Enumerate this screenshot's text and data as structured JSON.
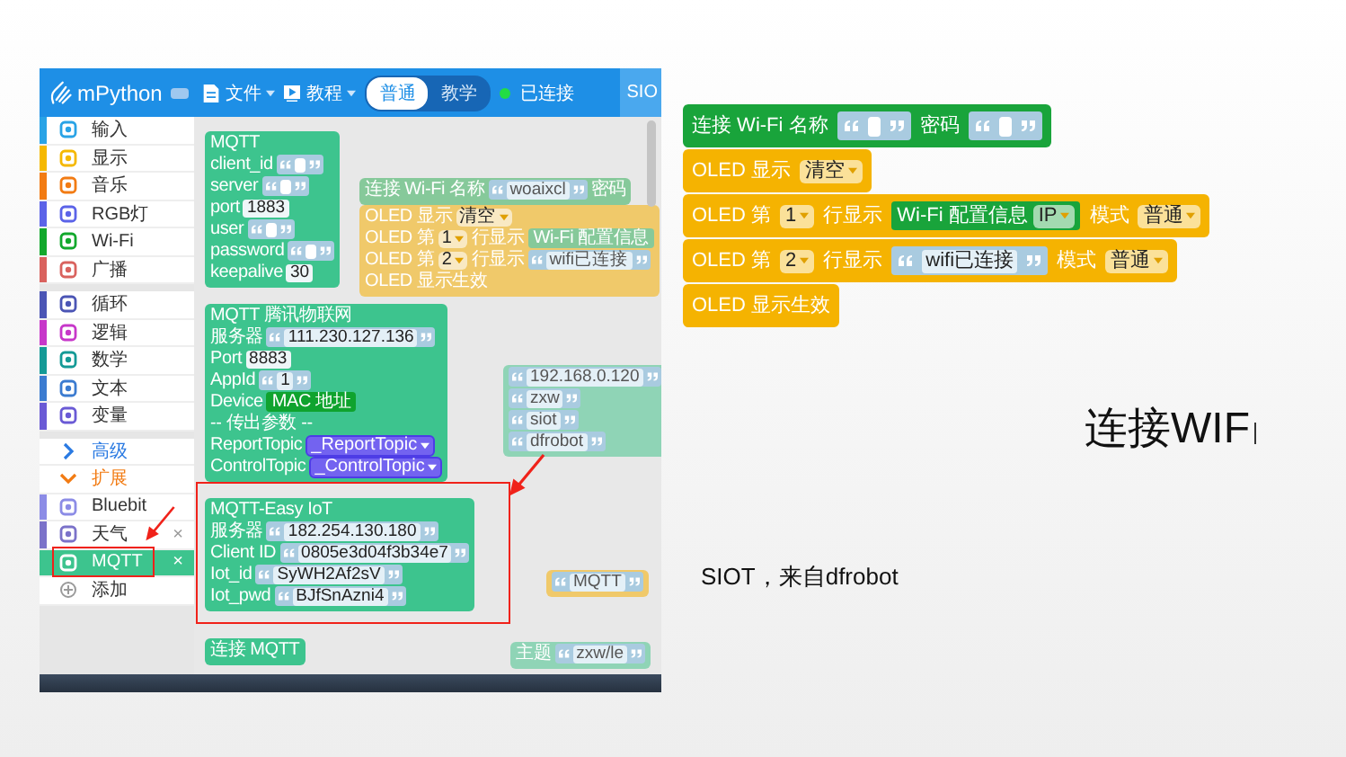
{
  "editor": {
    "logo": "mPython",
    "menus": [
      {
        "label": "文件",
        "kind": "file"
      },
      {
        "label": "教程",
        "kind": "tutorial"
      }
    ],
    "modes": [
      {
        "label": "普通",
        "selected": true
      },
      {
        "label": "教学",
        "selected": false
      }
    ],
    "connection": {
      "label": "已连接",
      "connected": true
    },
    "cut_button": "SIO",
    "sidebar": [
      [
        {
          "label": "输入",
          "kind": "category",
          "color": "#29a3e6"
        },
        {
          "label": "显示",
          "kind": "category",
          "color": "#f5b800"
        },
        {
          "label": "音乐",
          "kind": "category",
          "color": "#f27b13"
        },
        {
          "label": "RGB灯",
          "kind": "category",
          "color": "#5b63e8"
        },
        {
          "label": "Wi-Fi",
          "kind": "category",
          "color": "#12a82c"
        },
        {
          "label": "广播",
          "kind": "category",
          "color": "#d9625e"
        }
      ],
      [
        {
          "label": "循环",
          "kind": "category",
          "color": "#4b55b5"
        },
        {
          "label": "逻辑",
          "kind": "category",
          "color": "#c737c9"
        },
        {
          "label": "数学",
          "kind": "category",
          "color": "#149a96"
        },
        {
          "label": "文本",
          "kind": "category",
          "color": "#3b7bd0"
        },
        {
          "label": "变量",
          "kind": "category",
          "color": "#6a5ad5"
        }
      ],
      [
        {
          "label": "高级",
          "kind": "folder",
          "color": "#2a7ae2",
          "expanded": false
        },
        {
          "label": "扩展",
          "kind": "folder",
          "color": "#f27b13",
          "expanded": true
        },
        {
          "label": "Bluebit",
          "kind": "extension",
          "color": "#8c8ce6",
          "selected": false,
          "highlighted": false
        },
        {
          "label": "天气",
          "kind": "extension",
          "color": "#7b72c9",
          "close": "×",
          "selected": false,
          "highlighted": false
        },
        {
          "label": "MQTT",
          "kind": "extension",
          "color": "#3dc48e",
          "close": "×",
          "selected": true,
          "highlighted": true
        },
        {
          "label": "添加",
          "kind": "add",
          "color": "#9a9a9a"
        }
      ]
    ],
    "canvas_blocks": [
      {
        "color": "#3dc48e",
        "highlighted": false,
        "rows": [
          {
            "items": [
              {
                "kind": "label",
                "text": "MQTT"
              }
            ]
          },
          {
            "items": [
              {
                "kind": "label",
                "text": "client_id"
              },
              {
                "kind": "string"
              }
            ]
          },
          {
            "items": [
              {
                "kind": "label",
                "text": "server"
              },
              {
                "kind": "string"
              }
            ]
          },
          {
            "items": [
              {
                "kind": "label",
                "text": "port"
              },
              {
                "kind": "number",
                "value": "1883"
              }
            ]
          },
          {
            "items": [
              {
                "kind": "label",
                "text": "user"
              },
              {
                "kind": "string"
              }
            ]
          },
          {
            "items": [
              {
                "kind": "label",
                "text": "password"
              },
              {
                "kind": "string"
              }
            ]
          },
          {
            "items": [
              {
                "kind": "label",
                "text": "keepalive"
              },
              {
                "kind": "number",
                "value": "30"
              }
            ]
          }
        ]
      },
      {
        "color": "#3dc48e",
        "highlighted": false,
        "rows": [
          {
            "items": [
              {
                "kind": "label",
                "text": "MQTT 腾讯物联网"
              }
            ]
          },
          {
            "items": [
              {
                "kind": "label",
                "text": "服务器"
              },
              {
                "kind": "string",
                "value": "111.230.127.136"
              }
            ]
          },
          {
            "items": [
              {
                "kind": "label",
                "text": "Port"
              },
              {
                "kind": "number",
                "value": "8883"
              }
            ]
          },
          {
            "items": [
              {
                "kind": "label",
                "text": "AppId"
              },
              {
                "kind": "string",
                "value": "1"
              }
            ]
          },
          {
            "items": [
              {
                "kind": "label",
                "text": "Device"
              },
              {
                "kind": "reporter",
                "color": "#0fa32e",
                "items": [
                  {
                    "kind": "label",
                    "text": "MAC 地址"
                  }
                ]
              }
            ]
          },
          {
            "items": [
              {
                "kind": "label",
                "text": "-- 传出参数 --"
              }
            ]
          },
          {
            "items": [
              {
                "kind": "label",
                "text": "ReportTopic"
              },
              {
                "kind": "dropdown",
                "value": "_ReportTopic",
                "color": "#7363f0"
              }
            ]
          },
          {
            "items": [
              {
                "kind": "label",
                "text": "ControlTopic"
              },
              {
                "kind": "dropdown",
                "value": "_ControlTopic",
                "color": "#7363f0"
              }
            ]
          }
        ]
      },
      {
        "color": "#3dc48e",
        "highlighted": true,
        "rows": [
          {
            "items": [
              {
                "kind": "label",
                "text": "MQTT-Easy IoT"
              }
            ]
          },
          {
            "items": [
              {
                "kind": "label",
                "text": "服务器"
              },
              {
                "kind": "string",
                "value": "182.254.130.180"
              }
            ]
          },
          {
            "items": [
              {
                "kind": "label",
                "text": "Client ID"
              },
              {
                "kind": "string",
                "value": "0805e3d04f3b34e7"
              }
            ]
          },
          {
            "items": [
              {
                "kind": "label",
                "text": "Iot_id"
              },
              {
                "kind": "string",
                "value": "SyWH2Af2sV"
              }
            ]
          },
          {
            "items": [
              {
                "kind": "label",
                "text": "Iot_pwd"
              },
              {
                "kind": "string",
                "value": "BJfSnAzni4"
              }
            ]
          }
        ]
      },
      {
        "color": "#3dc48e",
        "highlighted": false,
        "rows": [
          {
            "items": [
              {
                "kind": "label",
                "text": "连接 MQTT"
              }
            ]
          }
        ]
      }
    ],
    "background_blocks": [
      {
        "kind": "wifi",
        "rows": [
          {
            "items": [
              {
                "kind": "label",
                "text": "连接 Wi-Fi 名称"
              },
              {
                "kind": "string",
                "value": "woaixcl"
              },
              {
                "kind": "label",
                "text": "密码"
              }
            ]
          }
        ]
      },
      {
        "kind": "display",
        "rows": [
          {
            "items": [
              {
                "kind": "label",
                "text": "OLED 显示"
              },
              {
                "kind": "dropdown",
                "value": "清空"
              }
            ]
          },
          {
            "items": [
              {
                "kind": "label",
                "text": "OLED 第"
              },
              {
                "kind": "dropdown",
                "value": "1"
              },
              {
                "kind": "label",
                "text": "行显示"
              },
              {
                "kind": "reporter",
                "items": [
                  {
                    "kind": "label",
                    "text": "Wi-Fi 配置信息"
                  }
                ]
              }
            ]
          },
          {
            "items": [
              {
                "kind": "label",
                "text": "OLED 第"
              },
              {
                "kind": "dropdown",
                "value": "2"
              },
              {
                "kind": "label",
                "text": "行显示"
              },
              {
                "kind": "string",
                "value": "wifi已连接"
              }
            ]
          },
          {
            "items": [
              {
                "kind": "label",
                "text": "OLED 显示生效"
              }
            ]
          }
        ]
      },
      {
        "kind": "mqtt",
        "rows": [
          {
            "items": [
              {
                "kind": "string",
                "value": "192.168.0.120"
              }
            ]
          },
          {
            "items": [
              {
                "kind": "string",
                "value": "zxw"
              }
            ]
          },
          {
            "items": [
              {
                "kind": "string",
                "value": "siot"
              }
            ]
          },
          {
            "items": [
              {
                "kind": "string",
                "value": "dfrobot"
              }
            ]
          }
        ]
      },
      {
        "kind": "display",
        "rows": [
          {
            "items": [
              {
                "kind": "string",
                "value": "MQTT"
              }
            ]
          }
        ]
      },
      {
        "kind": "mqtt",
        "rows": [
          {
            "items": [
              {
                "kind": "label",
                "text": "主题"
              },
              {
                "kind": "string",
                "value": "zxw/le"
              }
            ]
          }
        ]
      }
    ]
  },
  "slide_blocks": [
    {
      "color": "#19a43b",
      "rows": [
        {
          "items": [
            {
              "kind": "label",
              "text": "连接 Wi-Fi 名称"
            },
            {
              "kind": "string"
            },
            {
              "kind": "label",
              "text": "密码"
            },
            {
              "kind": "string"
            }
          ]
        }
      ]
    },
    {
      "color": "#f5b301",
      "rows": [
        {
          "items": [
            {
              "kind": "label",
              "text": "OLED 显示"
            },
            {
              "kind": "dropdown",
              "value": "清空"
            }
          ]
        }
      ]
    },
    {
      "color": "#f5b301",
      "rows": [
        {
          "items": [
            {
              "kind": "label",
              "text": "OLED 第"
            },
            {
              "kind": "dropdown",
              "value": "1"
            },
            {
              "kind": "label",
              "text": "行显示"
            },
            {
              "kind": "reporter",
              "color": "#19a43b",
              "items": [
                {
                  "kind": "label",
                  "text": "Wi-Fi 配置信息"
                },
                {
                  "kind": "dropdown",
                  "value": "IP"
                }
              ]
            },
            {
              "kind": "label",
              "text": "模式"
            },
            {
              "kind": "dropdown",
              "value": "普通"
            }
          ]
        }
      ]
    },
    {
      "color": "#f5b301",
      "rows": [
        {
          "items": [
            {
              "kind": "label",
              "text": "OLED 第"
            },
            {
              "kind": "dropdown",
              "value": "2"
            },
            {
              "kind": "label",
              "text": "行显示"
            },
            {
              "kind": "string",
              "value": "wifi已连接"
            },
            {
              "kind": "label",
              "text": "模式"
            },
            {
              "kind": "dropdown",
              "value": "普通"
            }
          ]
        }
      ]
    },
    {
      "color": "#f5b301",
      "rows": [
        {
          "items": [
            {
              "kind": "label",
              "text": "OLED 显示生效"
            }
          ]
        }
      ]
    }
  ],
  "title": "连接WIF",
  "caption": "SIOT，来自dfrobot"
}
